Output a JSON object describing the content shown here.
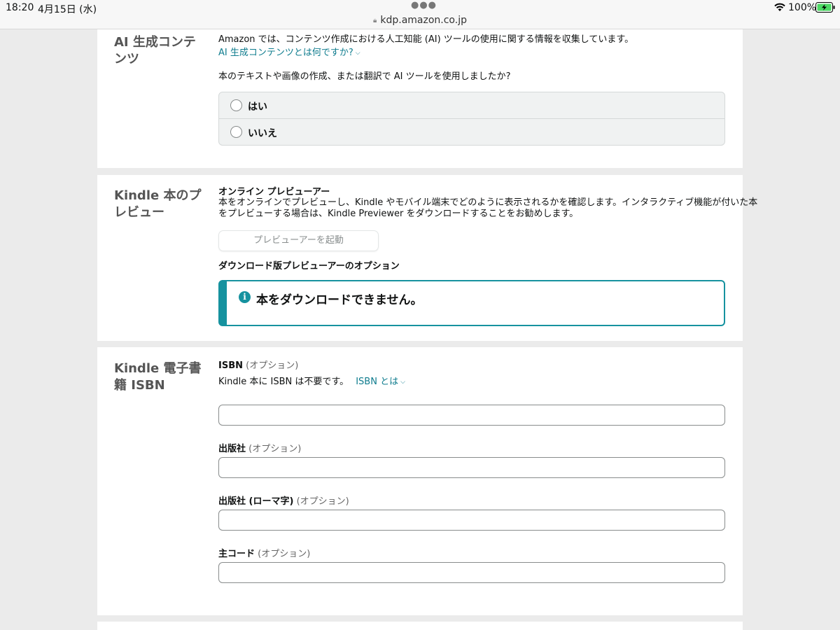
{
  "status": {
    "time": "18:20",
    "date": "4月15日 (水)",
    "url": "kdp.amazon.co.jp",
    "battery": "100%"
  },
  "ai_section": {
    "title": "AI 生成コンテンツ",
    "description": "Amazon では、コンテンツ作成における人工知能 (AI) ツールの使用に関する情報を収集しています。",
    "link": "AI 生成コンテンツとは何ですか?",
    "question": "本のテキストや画像の作成、または翻訳で AI ツールを使用しましたか?",
    "options": [
      "はい",
      "いいえ"
    ]
  },
  "preview_section": {
    "title": "Kindle 本のプレビュー",
    "online_heading": "オンライン プレビューアー",
    "online_desc_line1": "本をオンラインでプレビューし、Kindle やモバイル端末でどのように表示されるかを確認します。インタラクティブ機能が付いた本",
    "online_desc_line2": "をプレビューする場合は、Kindle Previewer をダウンロードすることをお勧めします。",
    "launch_button": "プレビューアーを起動",
    "download_heading": "ダウンロード版プレビューアーのオプション",
    "alert_message": "本をダウンロードできません。"
  },
  "isbn_section": {
    "title": "Kindle 電子書籍 ISBN",
    "isbn_label": "ISBN",
    "optional": "(オプション)",
    "isbn_note": "Kindle 本に ISBN は不要です。",
    "isbn_link": "ISBN とは",
    "publisher_label": "出版社",
    "publisher_romaji_label": "出版社 (ローマ字)",
    "main_code_label": "主コード",
    "isbn_value": "",
    "publisher_value": "",
    "publisher_romaji_value": "",
    "main_code_value": ""
  }
}
